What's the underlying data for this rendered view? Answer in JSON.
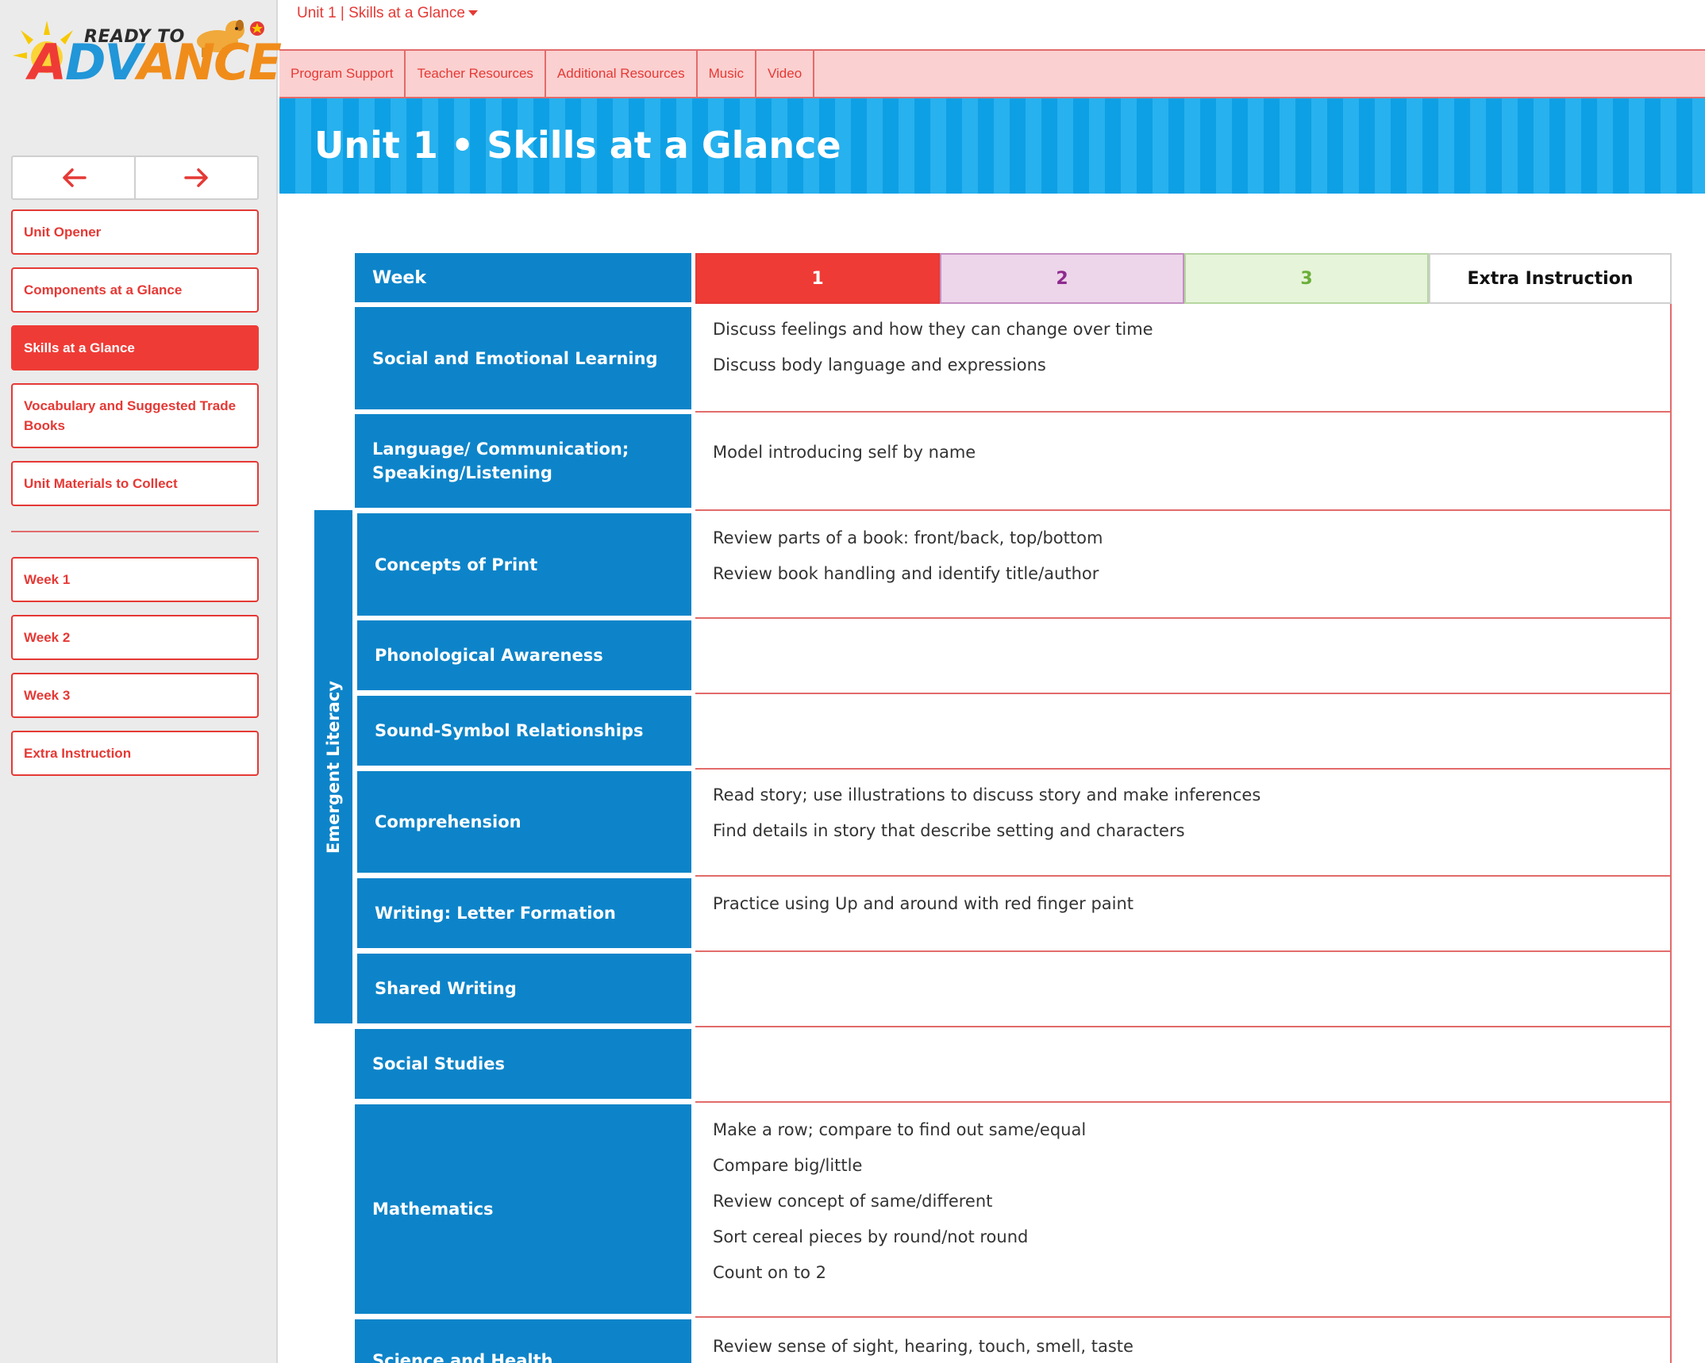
{
  "logo": {
    "top_text": "READY TO",
    "word_part1": "A",
    "word_part2": "DV",
    "word_part3": "ANCE"
  },
  "breadcrumb": {
    "text": "Unit 1 | Skills at a Glance"
  },
  "topnav": [
    "Program Support",
    "Teacher Resources",
    "Additional Resources",
    "Music",
    "Video"
  ],
  "banner": {
    "title": "Unit 1 • Skills at a Glance"
  },
  "sidebar": {
    "items": [
      {
        "label": "Unit Opener"
      },
      {
        "label": "Components at a Glance"
      },
      {
        "label": "Skills at a Glance"
      },
      {
        "label": "Vocabulary and Suggested Trade Books"
      },
      {
        "label": "Unit Materials to Collect"
      }
    ],
    "weeks": [
      {
        "label": "Week 1"
      },
      {
        "label": "Week 2"
      },
      {
        "label": "Week 3"
      },
      {
        "label": "Extra Instruction"
      }
    ]
  },
  "table": {
    "header": {
      "label": "Week",
      "weeks": [
        "1",
        "2",
        "3",
        "Extra Instruction"
      ]
    },
    "group_label": "Emergent Literacy",
    "rows": [
      {
        "label": "Social and Emotional Learning",
        "lines": [
          "Discuss feelings and how they can change over time",
          "Discuss body language and expressions"
        ]
      },
      {
        "label": "Language/ Communication; Speaking/Listening",
        "lines": [
          "Model introducing self by name"
        ]
      },
      {
        "label": "Concepts of Print",
        "lines": [
          "Review parts of a book: front/back, top/bottom",
          "Review book handling and identify title/author"
        ]
      },
      {
        "label": "Phonological Awareness",
        "lines": []
      },
      {
        "label": "Sound-Symbol Relationships",
        "lines": []
      },
      {
        "label": "Comprehension",
        "lines": [
          "Read story; use illustrations to discuss story and make inferences",
          "Find details in story that describe setting and characters"
        ]
      },
      {
        "label": "Writing: Letter Formation",
        "lines": [
          "Practice using Up and around with red finger paint"
        ]
      },
      {
        "label": "Shared Writing",
        "lines": []
      },
      {
        "label": "Social Studies",
        "lines": []
      },
      {
        "label": "Mathematics",
        "lines": [
          "Make a row; compare to find out same/equal",
          "Compare big/little",
          "Review concept of same/different",
          "Sort cereal pieces by round/not round",
          "Count on to 2"
        ]
      },
      {
        "label": "Science and Health",
        "lines": [
          "Review sense of sight, hearing, touch, smell, taste"
        ]
      }
    ]
  }
}
